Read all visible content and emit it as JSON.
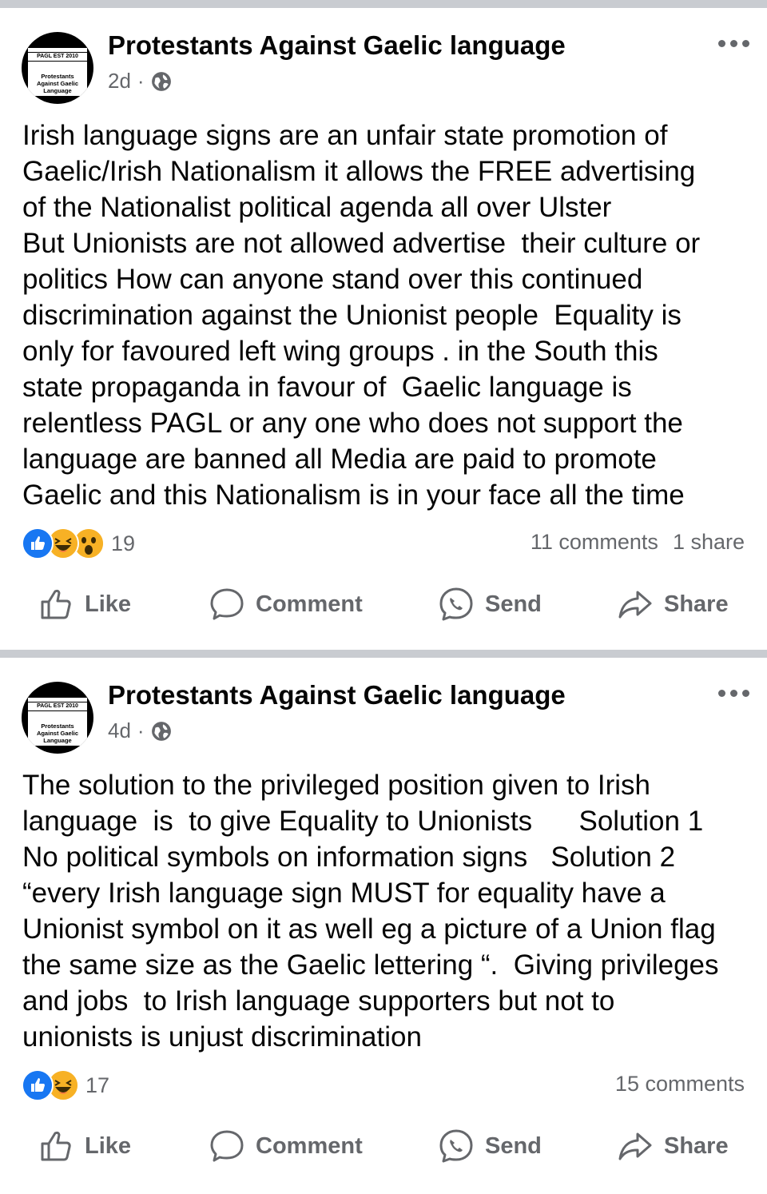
{
  "posts": [
    {
      "page_name": "Protestants Against Gaelic language",
      "avatar": {
        "tag": "PAGL EST 2010",
        "lines": [
          "Protestants",
          "Against Gaelic",
          "Language"
        ]
      },
      "time": "2d",
      "separator": "·",
      "body": [
        "Irish language signs are an unfair state promotion of",
        "Gaelic/Irish Nationalism it allows the FREE advertising",
        "of the Nationalist political agenda all over Ulster",
        "But Unionists are not allowed advertise  their culture or",
        "politics How can anyone stand over this continued",
        "discrimination against the Unionist people  Equality is",
        "only for favoured left wing groups . in the South this",
        "state propaganda in favour of  Gaelic language is",
        "relentless PAGL or any one who does not support the",
        "language are banned all Media are paid to promote",
        "Gaelic and this Nationalism is in your face all the time"
      ],
      "reactions": [
        "like",
        "haha",
        "wow"
      ],
      "reaction_count": "19",
      "comments": "11 comments",
      "shares": "1 share"
    },
    {
      "page_name": "Protestants Against Gaelic language",
      "avatar": {
        "tag": "PAGL EST 2010",
        "lines": [
          "Protestants",
          "Against Gaelic",
          "Language"
        ]
      },
      "time": "4d",
      "separator": "·",
      "body": [
        "The solution to the privileged position given to Irish",
        "language  is  to give Equality to Unionists      Solution 1",
        "No political symbols on information signs   Solution 2",
        "“every Irish language sign MUST for equality have a",
        "Unionist symbol on it as well eg a picture of a Union flag",
        "the same size as the Gaelic lettering “.  Giving privileges",
        "and jobs  to Irish language supporters but not to",
        "unionists is unjust discrimination"
      ],
      "reactions": [
        "like",
        "haha"
      ],
      "reaction_count": "17",
      "comments": "15 comments",
      "shares": ""
    }
  ],
  "actions": {
    "like": "Like",
    "comment": "Comment",
    "send": "Send",
    "share": "Share"
  },
  "icons": [
    "globe-icon",
    "more-options-icon",
    "thumbs-up-icon",
    "comment-bubble-icon",
    "messenger-icon",
    "share-arrow-icon"
  ],
  "colors": {
    "secondary_text": "#65676b",
    "like_blue": "#1877f2",
    "divider": "#c9ccd1"
  }
}
